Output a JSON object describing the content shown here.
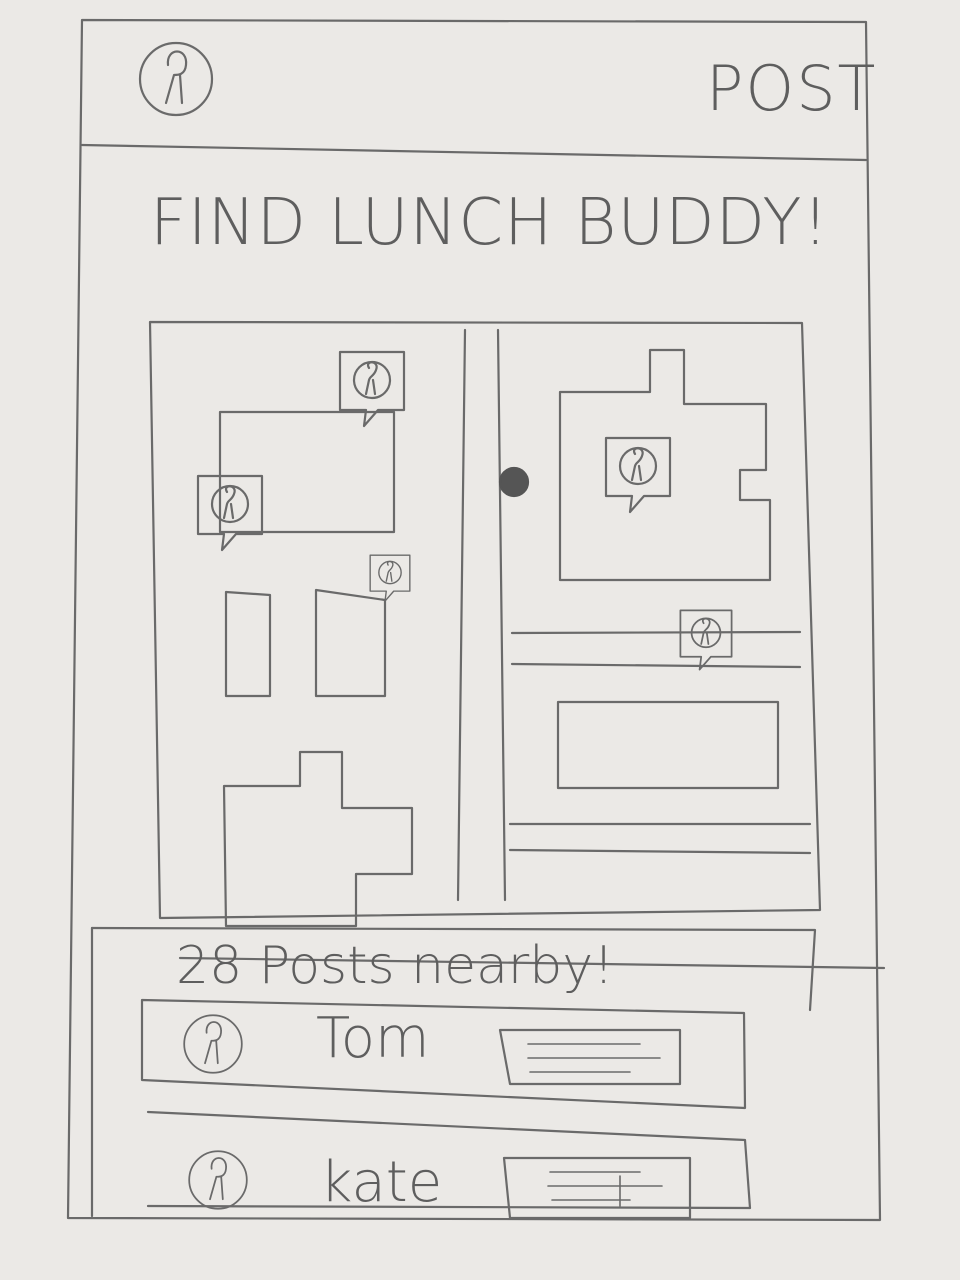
{
  "header": {
    "avatar_icon": "person-avatar-icon",
    "post_label": "POST"
  },
  "page": {
    "title": "FIND LUNCH BUDDY!"
  },
  "map": {
    "markers": [
      {
        "icon": "person-avatar-icon"
      },
      {
        "icon": "person-avatar-icon"
      },
      {
        "icon": "person-avatar-icon"
      },
      {
        "icon": "person-avatar-icon"
      },
      {
        "icon": "person-avatar-icon"
      }
    ],
    "current_location_icon": "location-dot-icon"
  },
  "posts": {
    "count_label": "28 Posts nearby!",
    "items": [
      {
        "name": "Tom",
        "icon": "person-avatar-icon"
      },
      {
        "name": "kate",
        "icon": "person-avatar-icon"
      }
    ]
  },
  "colors": {
    "paper": "#ebe9e6",
    "pencil": "#5e5e5e"
  }
}
